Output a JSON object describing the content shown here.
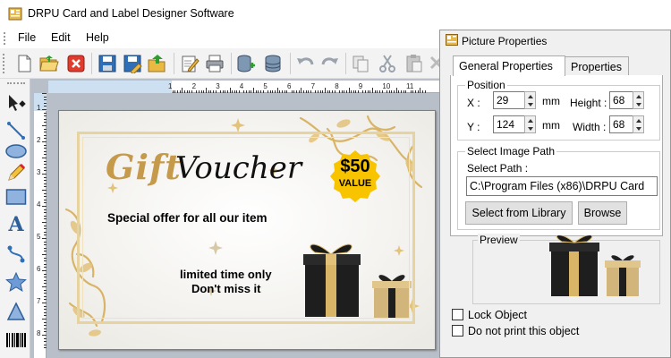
{
  "window": {
    "title": "DRPU Card and Label Designer Software",
    "icon": "app-icon"
  },
  "menu": [
    "File",
    "Edit",
    "Help"
  ],
  "toolbar": {
    "icons": [
      "new-icon",
      "open-icon",
      "close-icon",
      "save-icon",
      "save-as-icon",
      "export-icon",
      "edit-icon",
      "print-icon",
      "database-add-icon",
      "database-icon",
      "undo-icon",
      "redo-icon",
      "copy-icon",
      "cut-icon",
      "paste-icon",
      "delete-icon"
    ]
  },
  "left_tools": [
    "select-icon",
    "line-icon",
    "ellipse-icon",
    "pencil-icon",
    "rectangle-icon",
    "text-icon",
    "curve-icon",
    "star-icon",
    "triangle-icon",
    "barcode-icon"
  ],
  "ruler": {
    "h_labels": [
      "1",
      "2",
      "3",
      "4",
      "5",
      "6",
      "7",
      "8",
      "9",
      "10",
      "11"
    ],
    "v_labels": [
      "1",
      "2",
      "3",
      "4",
      "5",
      "6",
      "7",
      "8"
    ]
  },
  "card": {
    "word1": "Gift",
    "word2": "Voucher",
    "badge_price": "$50",
    "badge_value": "VALUE",
    "offer": "Special offer for all our item",
    "limited": "limited time only",
    "dont_miss": "Don't miss it",
    "colors": {
      "gold": "#c69a4b",
      "badge": "#f8c400",
      "frame": "#e7d39f"
    }
  },
  "panel": {
    "title": "Picture Properties",
    "tabs": [
      "General Properties",
      "Properties"
    ],
    "position": {
      "group_label": "Position",
      "x_label": "X :",
      "x_value": "29",
      "x_unit": "mm",
      "y_label": "Y :",
      "y_value": "124",
      "y_unit": "mm",
      "height_label": "Height :",
      "height_value": "68",
      "width_label": "Width :",
      "width_value": "68"
    },
    "image_path": {
      "group_label": "Select Image Path",
      "path_label": "Select Path :",
      "path_value": "C:\\Program Files (x86)\\DRPU Card",
      "library_button": "Select from Library",
      "browse_button": "Browse"
    },
    "preview_label": "Preview",
    "lock_label": "Lock Object",
    "noprint_label": "Do not print this object"
  }
}
